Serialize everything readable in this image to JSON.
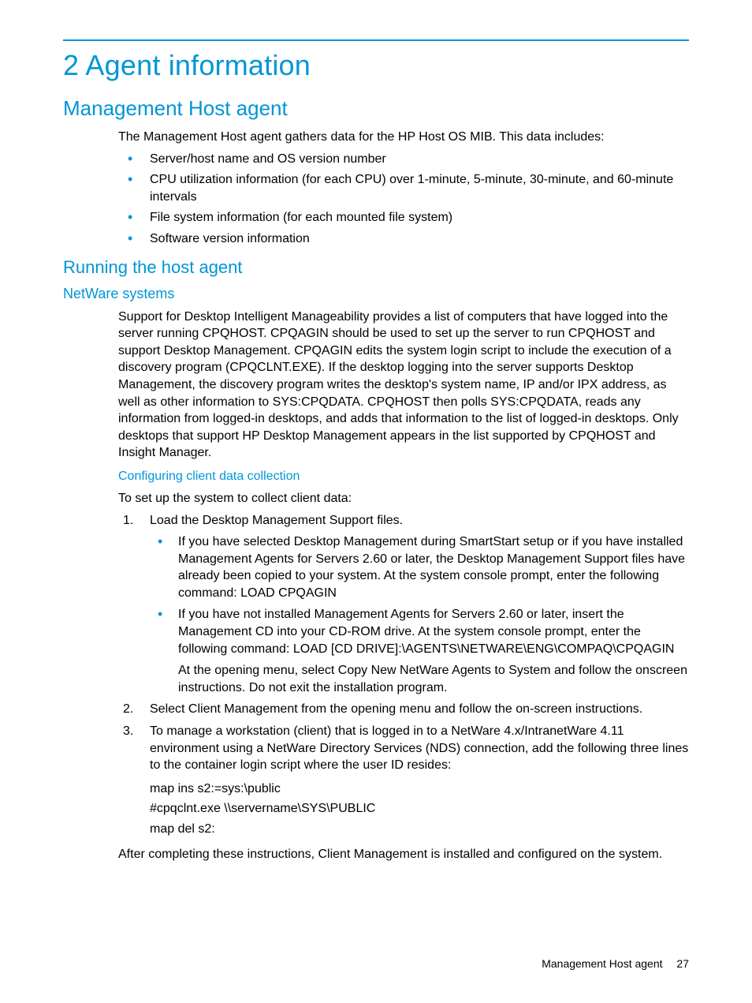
{
  "chapter_title": "2 Agent information",
  "s1": {
    "title": "Management Host agent",
    "intro": "The Management Host agent gathers data for the HP Host OS MIB. This data includes:",
    "bullets": [
      "Server/host name and OS version number",
      "CPU utilization information (for each CPU) over 1-minute, 5-minute, 30-minute, and 60-minute intervals",
      "File system information (for each mounted file system)",
      "Software version information"
    ]
  },
  "s2": {
    "title": "Running the host agent",
    "s3": {
      "title": "NetWare systems",
      "para": "Support for Desktop Intelligent Manageability provides a list of computers that have logged into the server running CPQHOST. CPQAGIN should be used to set up the server to run CPQHOST and support Desktop Management. CPQAGIN edits the system login script to include the execution of a discovery program (CPQCLNT.EXE). If the desktop logging into the server supports Desktop Management, the discovery program writes the desktop's system name, IP and/or IPX address, as well as other information to SYS:CPQDATA. CPQHOST then polls SYS:CPQDATA, reads any information from logged-in desktops, and adds that information to the list of logged-in desktops. Only desktops that support HP Desktop Management appears in the list supported by CPQHOST and Insight Manager.",
      "s4": {
        "title": "Configuring client data collection",
        "lead": "To set up the system to collect client data:",
        "step1": "Load the Desktop Management Support files.",
        "step1_sub": [
          "If you have selected Desktop Management during SmartStart setup or if you have installed Management Agents for Servers 2.60 or later, the Desktop Management Support files have already been copied to your system. At the system console prompt, enter the following command: LOAD CPQAGIN",
          "If you have not installed Management Agents for Servers 2.60 or later, insert the Management CD into your CD-ROM drive. At the system console prompt, enter the following command: LOAD [CD DRIVE]:\\AGENTS\\NETWARE\\ENG\\COMPAQ\\CPQAGIN"
        ],
        "step1_sub2_extra": "At the opening menu, select Copy New NetWare Agents to System and follow the onscreen instructions. Do not exit the installation program.",
        "step2": "Select Client Management from the opening menu and follow the on-screen instructions.",
        "step3": "To manage a workstation (client) that is logged in to a NetWare 4.x/IntranetWare 4.11 environment using a NetWare Directory Services (NDS) connection, add the following three lines to the container login script where the user ID resides:",
        "code": [
          "map ins s2:=sys:\\public",
          "#cpqclnt.exe \\\\servername\\SYS\\PUBLIC",
          "map del s2:"
        ],
        "closing": "After completing these instructions, Client Management is installed and configured on the system."
      }
    }
  },
  "footer": {
    "section": "Management Host agent",
    "page": "27"
  }
}
